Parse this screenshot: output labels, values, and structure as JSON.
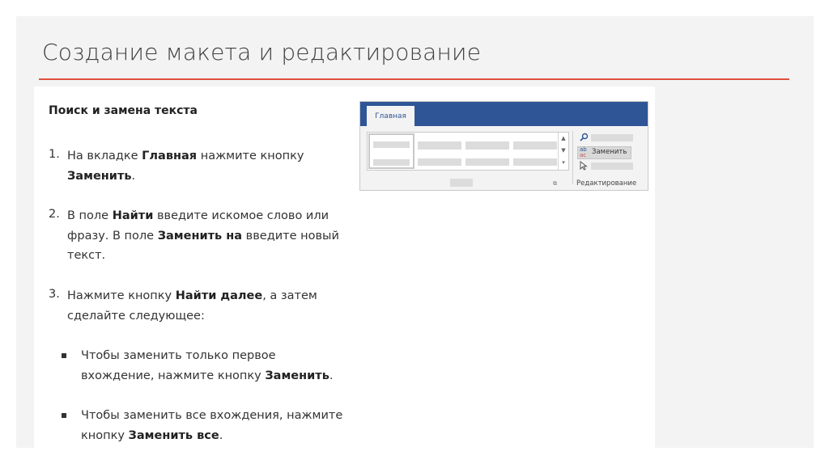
{
  "slide": {
    "title": "Создание макета и редактирование"
  },
  "article": {
    "heading": "Поиск и замена текста",
    "steps": [
      {
        "num": "1.",
        "line1_pre": "На вкладке ",
        "line1_b": "Главная",
        "line1_post": " нажмите кнопку",
        "line2_b": "Заменить",
        "line2_post": "."
      },
      {
        "num": "2.",
        "line1_pre": "В поле ",
        "line1_b": "Найти",
        "line1_post": " введите искомое слово или",
        "line2_pre": "фразу. В поле ",
        "line2_b": "Заменить на",
        "line2_post": " введите новый",
        "line3": "текст."
      },
      {
        "num": "3.",
        "line1_pre": "Нажмите кнопку ",
        "line1_b": "Найти далее",
        "line1_post": ", а затем",
        "line2": "сделайте следующее:"
      }
    ],
    "bullets": [
      {
        "line1": "Чтобы заменить только первое",
        "line2_pre": "вхождение, нажмите кнопку ",
        "line2_b": "Заменить",
        "line2_post": "."
      },
      {
        "line1": "Чтобы заменить все вхождения, нажмите",
        "line2_pre": "кнопку ",
        "line2_b": "Заменить все",
        "line2_post": "."
      }
    ]
  },
  "ribbon": {
    "tab_label": "Главная",
    "replace_label": "Заменить",
    "replace_icon_text": "ab",
    "group_label": "Редактирование",
    "scroll_up": "▲",
    "scroll_down": "▼",
    "scroll_more": "▾",
    "launcher_glyph": "⧉",
    "find_icon": "search-icon",
    "select_icon": "cursor-icon",
    "accent_color": "#2f5597",
    "rule_color": "#e2503c"
  }
}
